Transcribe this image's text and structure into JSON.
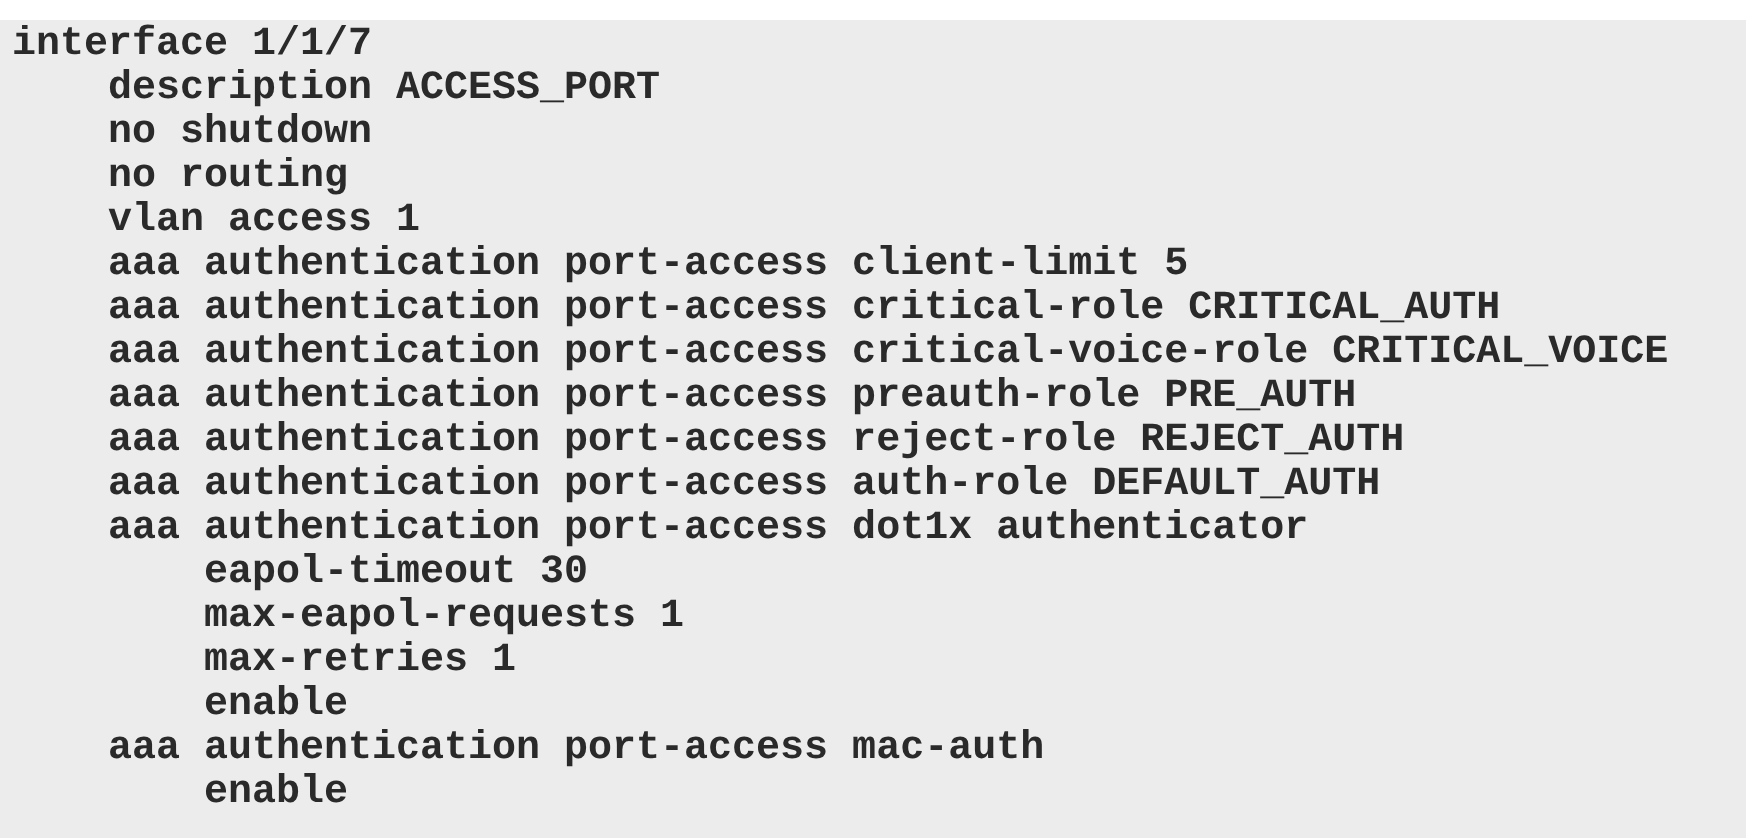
{
  "config": [
    {
      "text": "interface 1/1/7",
      "children": [
        {
          "text": "description ACCESS_PORT"
        },
        {
          "text": "no shutdown"
        },
        {
          "text": "no routing"
        },
        {
          "text": "vlan access 1"
        },
        {
          "text": "aaa authentication port-access client-limit 5"
        },
        {
          "text": "aaa authentication port-access critical-role CRITICAL_AUTH"
        },
        {
          "text": "aaa authentication port-access critical-voice-role CRITICAL_VOICE"
        },
        {
          "text": "aaa authentication port-access preauth-role PRE_AUTH"
        },
        {
          "text": "aaa authentication port-access reject-role REJECT_AUTH"
        },
        {
          "text": "aaa authentication port-access auth-role DEFAULT_AUTH"
        },
        {
          "text": "aaa authentication port-access dot1x authenticator",
          "children": [
            {
              "text": "eapol-timeout 30"
            },
            {
              "text": "max-eapol-requests 1"
            },
            {
              "text": "max-retries 1"
            },
            {
              "text": "enable"
            }
          ]
        },
        {
          "text": "aaa authentication port-access mac-auth",
          "children": [
            {
              "text": "enable"
            }
          ]
        }
      ]
    }
  ]
}
